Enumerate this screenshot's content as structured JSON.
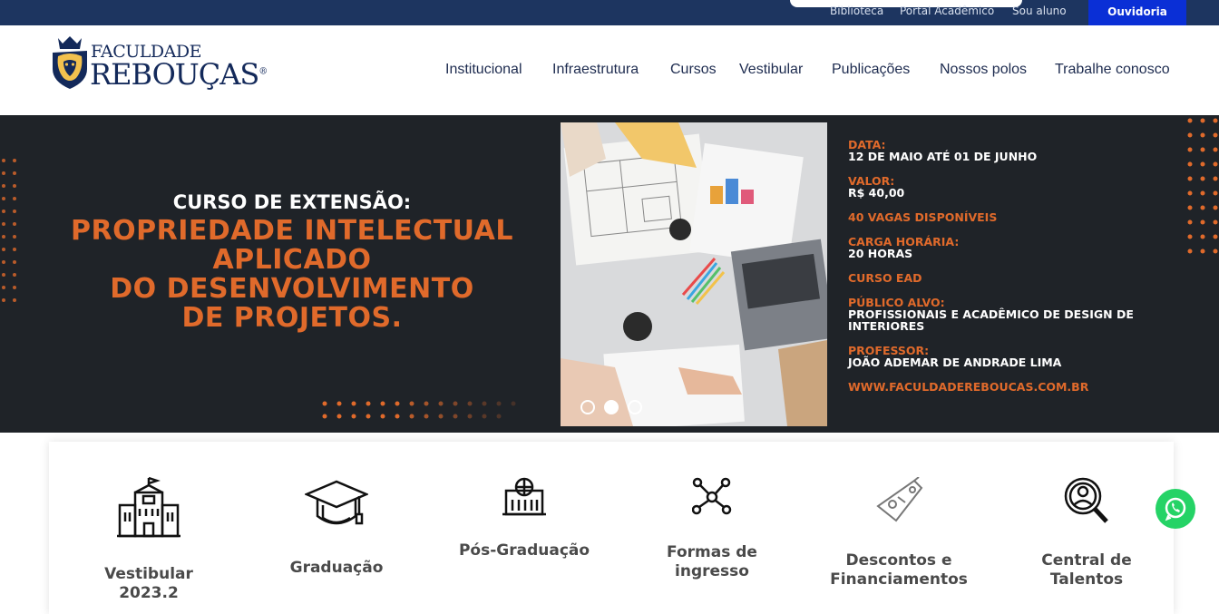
{
  "topbar": {
    "links": [
      "Biblioteca",
      "Portal Acadêmico",
      "Sou aluno"
    ],
    "ouvidoria": "Ouvidoria"
  },
  "logo": {
    "line1": "FACULDADE",
    "line2": "REBOUÇAS",
    "mark": "®"
  },
  "nav": [
    "Institucional",
    "Infraestrutura",
    "Cursos",
    "Vestibular",
    "Publicações",
    "Nossos polos",
    "Trabalhe conosco"
  ],
  "banner": {
    "kicker": "CURSO DE EXTENSÃO:",
    "title_lines": [
      "PROPRIEDADE INTELECTUAL",
      "APLICADO",
      "DO DESENVOLVIMENTO",
      "DE PROJETOS."
    ],
    "info": [
      {
        "label": "DATA:",
        "value": "12 DE MAIO ATÉ 01 DE JUNHO"
      },
      {
        "label": "VALOR:",
        "value": "R$ 40,00"
      },
      {
        "label": "40 VAGAS DISPONÍVEIS",
        "value": ""
      },
      {
        "label": "CARGA HORÁRIA:",
        "value": "20 HORAS"
      },
      {
        "label": "CURSO EAD",
        "value": ""
      },
      {
        "label": "PÚBLICO ALVO:",
        "value": "PROFISSIONAIS E ACADÊMICO DE DESIGN DE INTERIORES"
      },
      {
        "label": "PROFESSOR:",
        "value": "JOÃO ADEMAR DE ANDRADE LIMA"
      },
      {
        "label": "WWW.FACULDADEREBOUCAS.COM.BR",
        "value": ""
      }
    ],
    "slides": 3,
    "active_slide": 2
  },
  "cards": [
    {
      "label_lines": [
        "Vestibular",
        "2023.2"
      ],
      "icon": "building-icon"
    },
    {
      "label_lines": [
        "Graduação"
      ],
      "icon": "graduation-cap-icon"
    },
    {
      "label_lines": [
        "Pós-Graduação"
      ],
      "icon": "school-icon"
    },
    {
      "label_lines": [
        "Formas de",
        "ingresso"
      ],
      "icon": "network-icon"
    },
    {
      "label_lines": [
        "Descontos e",
        "Financiamentos"
      ],
      "icon": "price-tag-icon"
    },
    {
      "label_lines": [
        "Central de",
        "Talentos"
      ],
      "icon": "talent-search-icon"
    }
  ],
  "colors": {
    "topbar": "#1d3560",
    "ouvidoria": "#0a2fd6",
    "accent_orange": "#e06a2b",
    "banner_bg": "#1f2328",
    "whatsapp": "#25d366"
  }
}
